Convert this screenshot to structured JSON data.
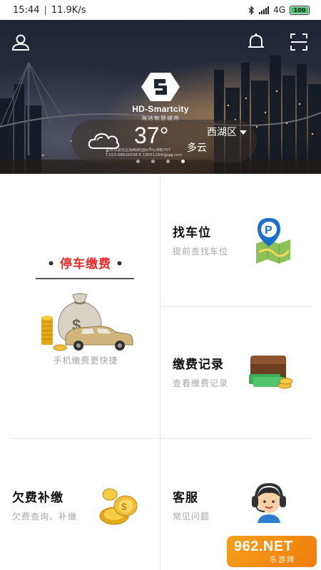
{
  "status_bar": {
    "time": "15:44",
    "network_speed": "11.9K/s",
    "network_type": "4G",
    "battery": "100"
  },
  "banner": {
    "brand_en": "HD-Smartcity",
    "brand_cn": "海达智慧城市",
    "temperature": "37°",
    "district": "西湖区",
    "condition": "多云",
    "address_line1": "重庆市渝北区棕榈泉国际中心B栋707",
    "address_line2": "T.023-68626598  E.18051264l@qq.com",
    "icons": [
      "user-icon",
      "bell-icon",
      "scan-icon",
      "cloud-icon"
    ]
  },
  "menu": {
    "parking_pay": {
      "title": "停车缴费",
      "subtitle": "手机缴费更快捷",
      "icon": "money-bag-car-icon"
    },
    "find_spot": {
      "title": "找车位",
      "subtitle": "提前查找车位",
      "icon": "parking-map-icon"
    },
    "pay_records": {
      "title": "缴费记录",
      "subtitle": "查看缴费记录",
      "icon": "wallet-icon"
    },
    "arrears": {
      "title": "欠费补缴",
      "subtitle": "欠费查询、补缴",
      "icon": "gold-coins-icon"
    },
    "service": {
      "title": "客服",
      "subtitle": "常见问题",
      "icon": "support-agent-icon"
    }
  },
  "watermark": {
    "main": "962.NET",
    "sub": "乐游网"
  },
  "colors": {
    "accent_red": "#e02b2b",
    "divider": "#e6e6e6",
    "subtitle_gray": "#a8a8a8",
    "watermark_orange": "#f39015"
  }
}
